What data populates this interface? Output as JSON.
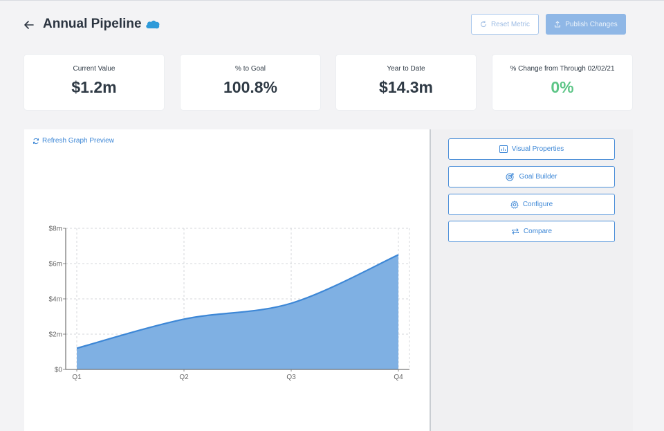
{
  "header": {
    "title": "Annual Pipeline",
    "reset_label": "Reset Metric",
    "publish_label": "Publish Changes"
  },
  "metrics": [
    {
      "label": "Current Value",
      "value": "$1.2m"
    },
    {
      "label": "% to Goal",
      "value": "100.8%"
    },
    {
      "label": "Year to Date",
      "value": "$14.3m"
    },
    {
      "label": "% Change from Through 02/02/21",
      "value": "0%"
    }
  ],
  "graph": {
    "refresh_label": "Refresh Graph Preview"
  },
  "side_buttons": [
    {
      "label": "Visual Properties",
      "icon": "bar-chart-icon"
    },
    {
      "label": "Goal Builder",
      "icon": "target-icon"
    },
    {
      "label": "Configure",
      "icon": "gear-icon"
    },
    {
      "label": "Compare",
      "icon": "swap-arrows-icon"
    }
  ],
  "colors": {
    "accent": "#3d87d6",
    "area_fill": "#7fb0e3",
    "positive": "#5cc586"
  },
  "chart_data": {
    "type": "area",
    "categories": [
      "Q1",
      "Q2",
      "Q3",
      "Q4"
    ],
    "series": [
      {
        "values": [
          1.2,
          2.85,
          3.75,
          6.5
        ]
      }
    ],
    "yticks": [
      "$0",
      "$2m",
      "$4m",
      "$6m",
      "$8m"
    ],
    "ylim": [
      0,
      8
    ],
    "grid": true
  }
}
